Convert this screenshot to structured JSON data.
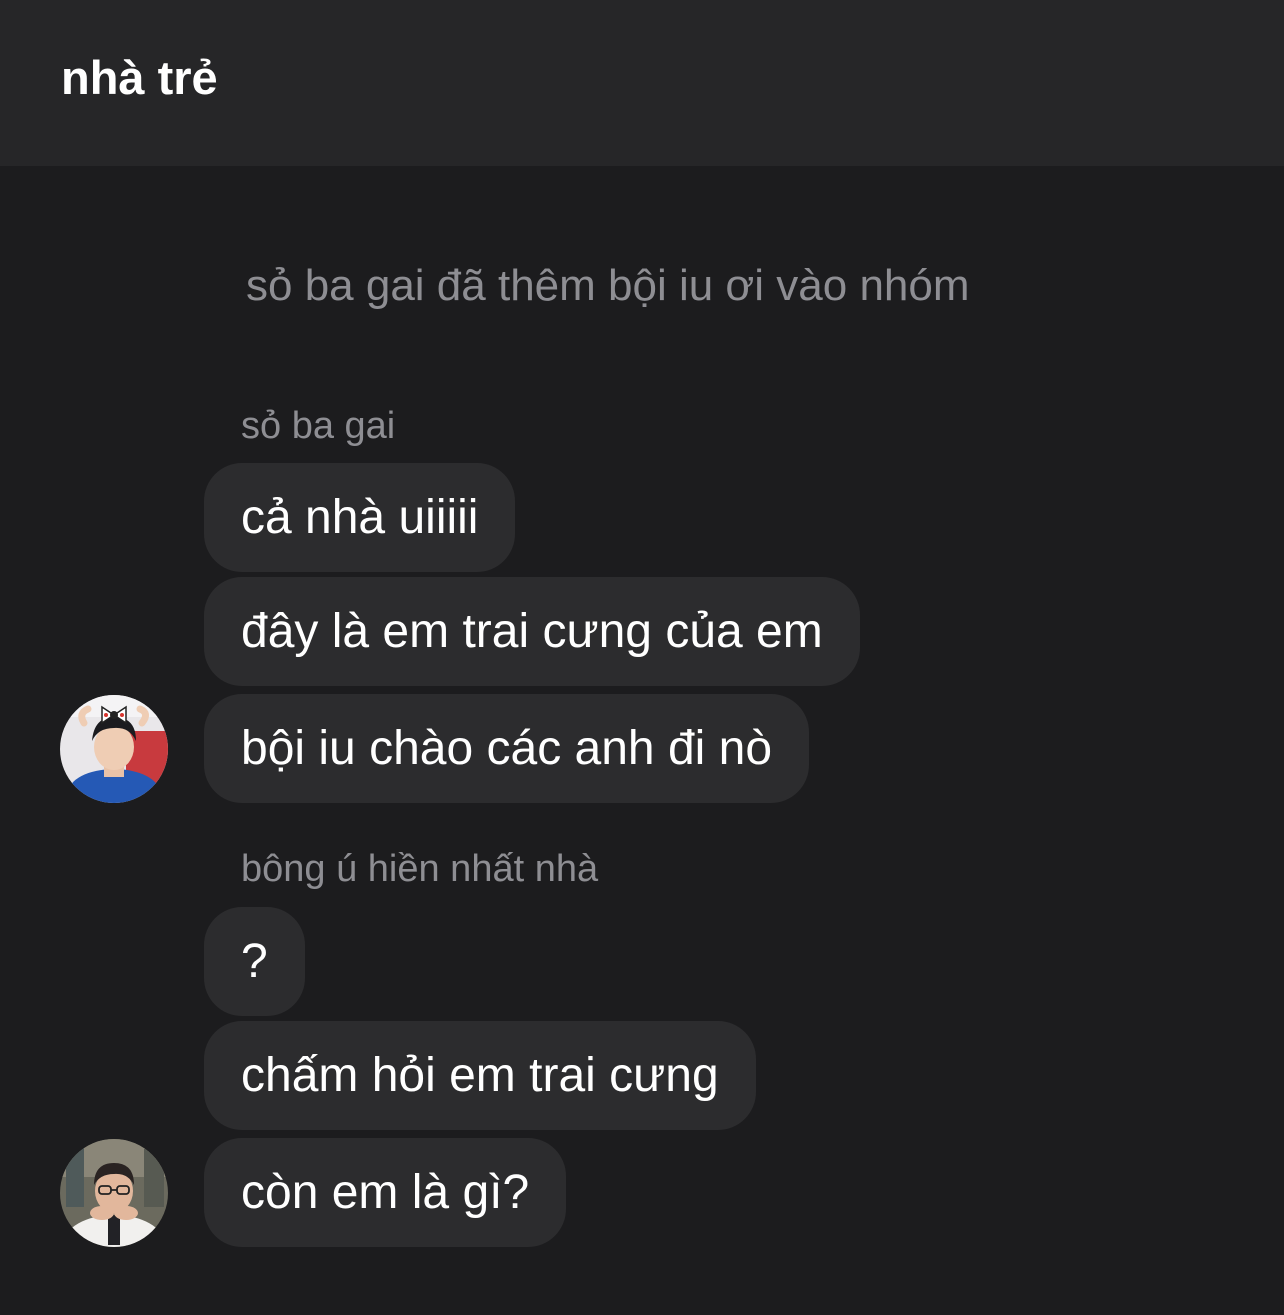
{
  "header": {
    "title": "nhà trẻ"
  },
  "system_message": "sỏ ba gai đã thêm bội iu ơi vào nhóm",
  "groups": [
    {
      "sender": "sỏ ba gai",
      "avatar_icon": "user-avatar-bow-boy",
      "messages": [
        "cả nhà uiiiii",
        "đây là em trai cưng của em",
        "bội iu chào các anh đi nò"
      ]
    },
    {
      "sender": "bông ú hiền nhất nhà",
      "avatar_icon": "user-avatar-glasses-boy",
      "messages": [
        "?",
        "chấm hỏi em trai cưng",
        "còn em là gì?"
      ]
    }
  ],
  "colors": {
    "background": "#1c1c1e",
    "header_background": "#262628",
    "bubble": "#2c2c2e",
    "secondary_text": "#8e8e93",
    "primary_text": "#ffffff"
  }
}
